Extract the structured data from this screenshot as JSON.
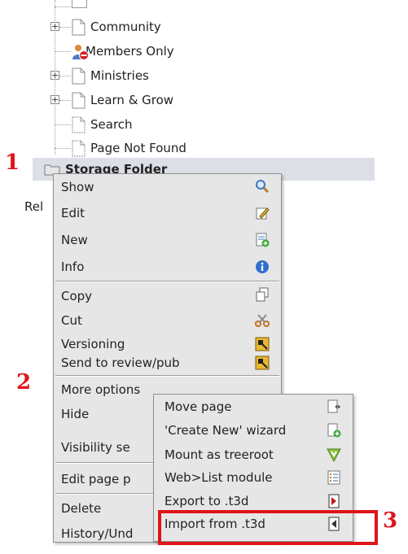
{
  "tree": {
    "items": [
      {
        "label": "Community"
      },
      {
        "label": "Members Only"
      },
      {
        "label": "Ministries"
      },
      {
        "label": "Learn & Grow"
      },
      {
        "label": "Search"
      },
      {
        "label": "Page Not Found"
      },
      {
        "label": "Storage Folder"
      }
    ],
    "partial_label": "Rel"
  },
  "markers": {
    "m1": "1",
    "m2": "2",
    "m3": "3"
  },
  "context_menu": {
    "items": [
      {
        "label": "Show",
        "icon": "magnifier-icon"
      },
      {
        "label": "Edit",
        "icon": "pencil-icon"
      },
      {
        "label": "New",
        "icon": "new-page-icon"
      },
      {
        "label": "Info",
        "icon": "info-icon"
      },
      {
        "label": "Copy",
        "icon": "copy-icon"
      },
      {
        "label": "Cut",
        "icon": "scissors-icon"
      },
      {
        "label": "Versioning",
        "icon": "versioning-icon"
      },
      {
        "label": "Send to review/pub",
        "icon": "review-icon"
      },
      {
        "label": "More options",
        "icon": ""
      },
      {
        "label": "Hide",
        "icon": ""
      },
      {
        "label": "Visibility se",
        "icon": ""
      },
      {
        "label": "Edit page p",
        "icon": ""
      },
      {
        "label": "Delete",
        "icon": ""
      },
      {
        "label": "History/Und",
        "icon": ""
      }
    ]
  },
  "submenu": {
    "items": [
      {
        "label": "Move page",
        "icon": "move-page-icon"
      },
      {
        "label": "'Create New' wizard",
        "icon": "wizard-icon"
      },
      {
        "label": "Mount as treeroot",
        "icon": "mount-icon"
      },
      {
        "label": "Web>List module",
        "icon": "list-module-icon"
      },
      {
        "label": "Export to .t3d",
        "icon": "export-icon"
      },
      {
        "label": "Import from .t3d",
        "icon": "import-icon"
      }
    ]
  },
  "colors": {
    "accent": "#e0141a",
    "menu_bg": "#e6e6e6",
    "selection_bg": "#dcdfe6"
  }
}
